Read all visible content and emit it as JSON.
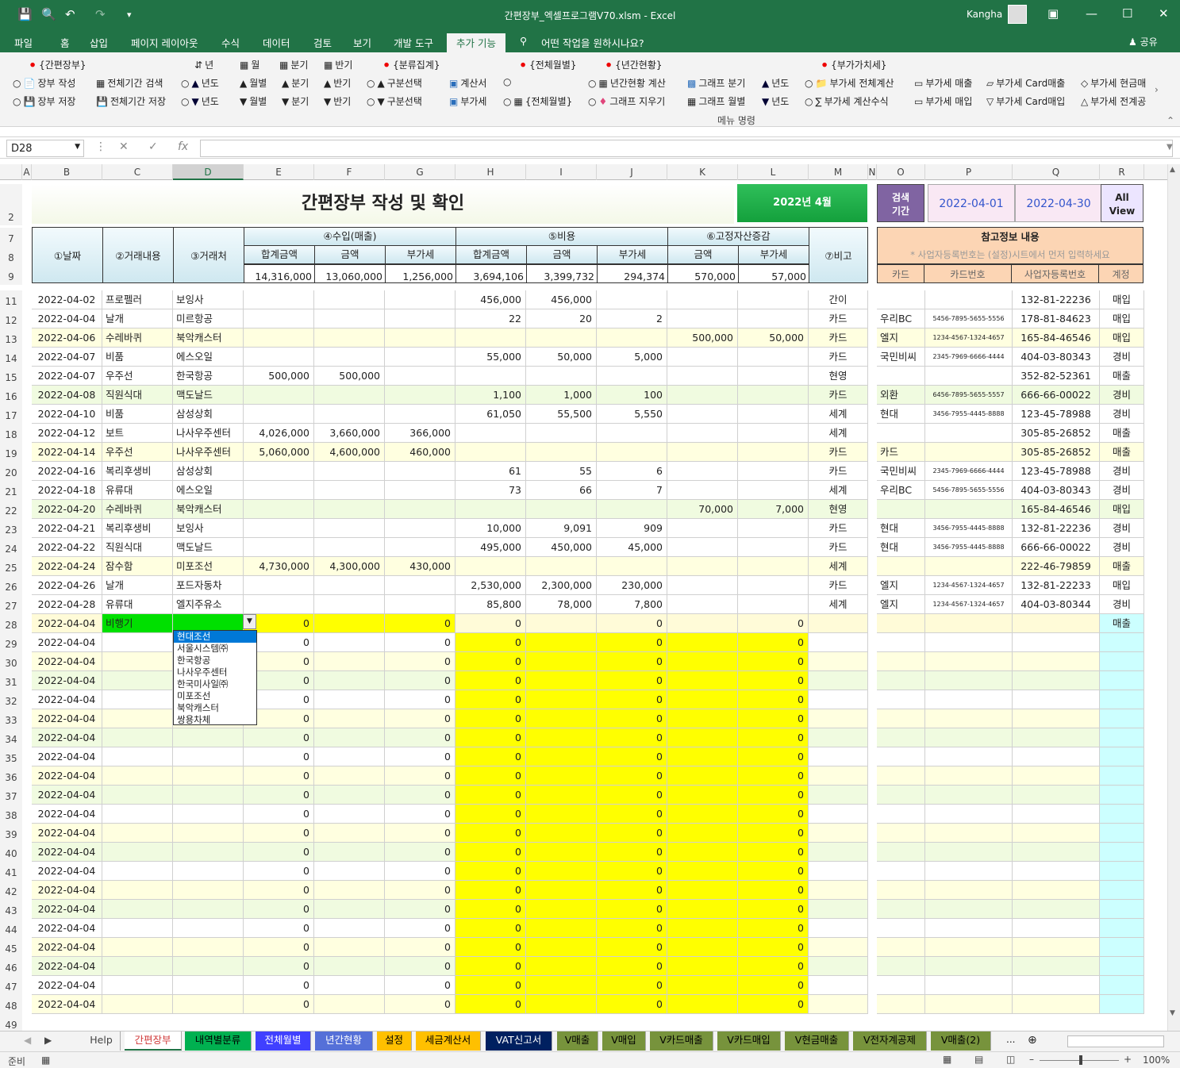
{
  "window": {
    "title": "간편장부_엑셀프로그램V70.xlsm  -  Excel",
    "user": "Kangha"
  },
  "menu": {
    "items": [
      "파일",
      "홈",
      "삽입",
      "페이지 레이아웃",
      "수식",
      "데이터",
      "검토",
      "보기",
      "개발 도구",
      "추가 기능"
    ],
    "active": "추가 기능",
    "tell_me": "어떤 작업을 원하시나요?",
    "share": "공유"
  },
  "ribbon": {
    "group_label": "메뉴 명령",
    "headers": [
      "{간편장부}",
      "{분류집계}",
      "{전체월별}",
      "{년간현황}",
      "{부가가치세}"
    ],
    "row1": [
      "장부 작성",
      "전체기간 검색",
      "년도",
      "월별",
      "분기",
      "반기",
      "구분선택",
      "계산서",
      "년간현황 계산",
      "그래프 분기",
      "년도",
      "부가세 전체계산",
      "부가세 매출",
      "부가세 Card매출",
      "부가세 현금매"
    ],
    "row2": [
      "장부 저장",
      "전체기간 저장",
      "년도",
      "월별",
      "분기",
      "반기",
      "구분선택",
      "부가세",
      "{전체월별}",
      "그래프 지우기",
      "그래프 월별",
      "년도",
      "부가세 계산수식",
      "부가세 매입",
      "부가세 Card매입",
      "부가세 전계공"
    ],
    "top_buttons": [
      "년",
      "월",
      "분기",
      "반기"
    ]
  },
  "formula_bar": {
    "name_box": "D28",
    "fx": "fx",
    "value": ""
  },
  "columns": [
    "A",
    "B",
    "C",
    "D",
    "E",
    "F",
    "G",
    "H",
    "I",
    "J",
    "K",
    "L",
    "M",
    "N",
    "O",
    "P",
    "Q",
    "R"
  ],
  "selected_column": "D",
  "rows": [
    "2",
    "7",
    "8",
    "9",
    "11",
    "12",
    "13",
    "14",
    "15",
    "16",
    "17",
    "18",
    "19",
    "20",
    "21",
    "22",
    "23",
    "24",
    "25",
    "26",
    "27",
    "28",
    "29",
    "30",
    "31",
    "32",
    "33",
    "34",
    "35",
    "36",
    "37",
    "38",
    "39",
    "40",
    "41",
    "42",
    "43",
    "44",
    "45",
    "46",
    "47",
    "48",
    "49"
  ],
  "sheet": {
    "title": "간편장부 작성 및 확인",
    "month_badge": "2022년 4월",
    "search_label": "검색\n기간",
    "search_from": "2022-04-01",
    "search_to": "2022-04-30",
    "all_view": "All\nView",
    "headers": {
      "date": "①날짜",
      "desc": "②거래내용",
      "vendor": "③거래처",
      "income": "④수입(매출)",
      "expense": "⑤비용",
      "fixed": "⑥고정자산증감",
      "note": "⑦비고",
      "total": "합계금액",
      "amount": "금액",
      "vat": "부가세",
      "ref_title": "참고정보 내용",
      "ref_note": "* 사업자등록번호는 (설정)시트에서 먼저 입력하세요",
      "card": "카드",
      "card_no": "카드번호",
      "biz_no": "사업자등록번호",
      "account": "계정"
    },
    "totals": [
      "14,316,000",
      "13,060,000",
      "1,256,000",
      "3,694,106",
      "3,399,732",
      "294,374",
      "570,000",
      "57,000"
    ],
    "data_rows": [
      [
        "2022-04-02",
        "프로펠러",
        "보잉사",
        "",
        "",
        "",
        "456,000",
        "456,000",
        "",
        "",
        "",
        "간이",
        "",
        "",
        "132-81-22236",
        "매입"
      ],
      [
        "2022-04-04",
        "날개",
        "미르항공",
        "",
        "",
        "",
        "22",
        "20",
        "2",
        "",
        "",
        "카드",
        "우리BC",
        "5456-7895-5655-5556",
        "178-81-84623",
        "매입"
      ],
      [
        "2022-04-06",
        "수레바퀴",
        "북악캐스터",
        "",
        "",
        "",
        "",
        "",
        "",
        "500,000",
        "50,000",
        "카드",
        "엘지",
        "1234-4567-1324-4657",
        "165-84-46546",
        "매입"
      ],
      [
        "2022-04-07",
        "비품",
        "에스오일",
        "",
        "",
        "",
        "55,000",
        "50,000",
        "5,000",
        "",
        "",
        "카드",
        "국민비씨",
        "2345-7969-6666-4444",
        "404-03-80343",
        "경비"
      ],
      [
        "2022-04-07",
        "우주선",
        "한국항공",
        "500,000",
        "500,000",
        "",
        "",
        "",
        "",
        "",
        "",
        "현영",
        "",
        "",
        "352-82-52361",
        "매출"
      ],
      [
        "2022-04-08",
        "직원식대",
        "맥도날드",
        "",
        "",
        "",
        "1,100",
        "1,000",
        "100",
        "",
        "",
        "카드",
        "외환",
        "6456-7895-5655-5557",
        "666-66-00022",
        "경비"
      ],
      [
        "2022-04-10",
        "비품",
        "삼성상회",
        "",
        "",
        "",
        "61,050",
        "55,500",
        "5,550",
        "",
        "",
        "세계",
        "현대",
        "3456-7955-4445-8888",
        "123-45-78988",
        "경비"
      ],
      [
        "2022-04-12",
        "보트",
        "나사우주센터",
        "4,026,000",
        "3,660,000",
        "366,000",
        "",
        "",
        "",
        "",
        "",
        "세계",
        "",
        "",
        "305-85-26852",
        "매출"
      ],
      [
        "2022-04-14",
        "우주선",
        "나사우주센터",
        "5,060,000",
        "4,600,000",
        "460,000",
        "",
        "",
        "",
        "",
        "",
        "카드",
        "카드",
        "",
        "305-85-26852",
        "매출"
      ],
      [
        "2022-04-16",
        "복리후생비",
        "삼성상회",
        "",
        "",
        "",
        "61",
        "55",
        "6",
        "",
        "",
        "카드",
        "국민비씨",
        "2345-7969-6666-4444",
        "123-45-78988",
        "경비"
      ],
      [
        "2022-04-18",
        "유류대",
        "에스오일",
        "",
        "",
        "",
        "73",
        "66",
        "7",
        "",
        "",
        "세계",
        "우리BC",
        "5456-7895-5655-5556",
        "404-03-80343",
        "경비"
      ],
      [
        "2022-04-20",
        "수레바퀴",
        "북악캐스터",
        "",
        "",
        "",
        "",
        "",
        "",
        "70,000",
        "7,000",
        "현영",
        "",
        "",
        "165-84-46546",
        "매입"
      ],
      [
        "2022-04-21",
        "복리후생비",
        "보잉사",
        "",
        "",
        "",
        "10,000",
        "9,091",
        "909",
        "",
        "",
        "카드",
        "현대",
        "3456-7955-4445-8888",
        "132-81-22236",
        "경비"
      ],
      [
        "2022-04-22",
        "직원식대",
        "맥도날드",
        "",
        "",
        "",
        "495,000",
        "450,000",
        "45,000",
        "",
        "",
        "카드",
        "현대",
        "3456-7955-4445-8888",
        "666-66-00022",
        "경비"
      ],
      [
        "2022-04-24",
        "잠수함",
        "미포조선",
        "4,730,000",
        "4,300,000",
        "430,000",
        "",
        "",
        "",
        "",
        "",
        "세계",
        "",
        "",
        "222-46-79859",
        "매출"
      ],
      [
        "2022-04-26",
        "날개",
        "포드자동차",
        "",
        "",
        "",
        "2,530,000",
        "2,300,000",
        "230,000",
        "",
        "",
        "카드",
        "엘지",
        "1234-4567-1324-4657",
        "132-81-22233",
        "매입"
      ],
      [
        "2022-04-28",
        "유류대",
        "엘지주유소",
        "",
        "",
        "",
        "85,800",
        "78,000",
        "7,800",
        "",
        "",
        "세계",
        "엘지",
        "1234-4567-1324-4657",
        "404-03-80344",
        "경비"
      ],
      [
        "2022-04-04",
        "비행기",
        "",
        "0",
        "",
        "0",
        "0",
        "",
        "0",
        "",
        "0",
        "",
        "",
        "",
        "",
        "매출"
      ]
    ],
    "empty_date": "2022-04-04",
    "empty_zero": "0",
    "dropdown_options": [
      "현대조선",
      "서울시스템㈜",
      "한국항공",
      "나사우주센터",
      "한국미사일㈜",
      "미포조선",
      "북악캐스터",
      "쌍용차체"
    ]
  },
  "tabs": [
    {
      "label": "Help",
      "bg": "#f3f3f3",
      "fg": "#444"
    },
    {
      "label": "간편장부",
      "bg": "#ffffff",
      "fg": "#d03a3a"
    },
    {
      "label": "내역별분류",
      "bg": "#00b050",
      "fg": "#000"
    },
    {
      "label": "전체월별",
      "bg": "#4040ff",
      "fg": "#fff"
    },
    {
      "label": "년간현황",
      "bg": "#5570d8",
      "fg": "#fff"
    },
    {
      "label": "설정",
      "bg": "#ffc000",
      "fg": "#000"
    },
    {
      "label": "세금계산서",
      "bg": "#ffc000",
      "fg": "#000"
    },
    {
      "label": "VAT신고서",
      "bg": "#002060",
      "fg": "#fff"
    },
    {
      "label": "V매출",
      "bg": "#77933c",
      "fg": "#000"
    },
    {
      "label": "V매입",
      "bg": "#77933c",
      "fg": "#000"
    },
    {
      "label": "V카드매출",
      "bg": "#77933c",
      "fg": "#000"
    },
    {
      "label": "V카드매입",
      "bg": "#77933c",
      "fg": "#000"
    },
    {
      "label": "V현금매출",
      "bg": "#77933c",
      "fg": "#000"
    },
    {
      "label": "V전자계공제",
      "bg": "#77933c",
      "fg": "#000"
    },
    {
      "label": "V매출(2)",
      "bg": "#77933c",
      "fg": "#000"
    }
  ],
  "tabs_more": "...",
  "status": {
    "ready": "준비",
    "zoom": "100%"
  }
}
